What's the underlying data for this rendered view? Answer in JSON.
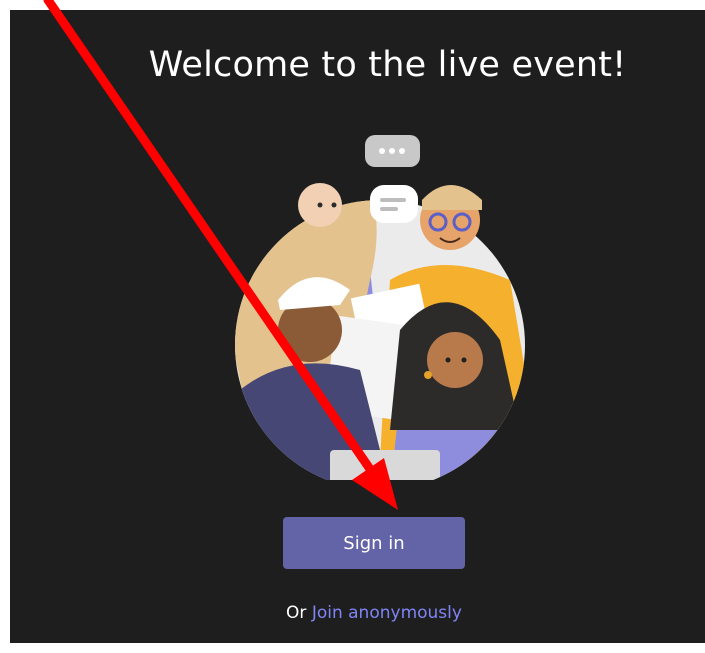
{
  "welcome": {
    "title": "Welcome to the live event!"
  },
  "actions": {
    "signin_label": "Sign in",
    "or_text": "Or ",
    "join_label": "Join anonymously"
  },
  "colors": {
    "background": "#1f1e1f",
    "button": "#6264a7",
    "link": "#7f85f5",
    "annotation_arrow": "#ff0000"
  },
  "icons": {
    "illustration": "people-group-illustration",
    "annotation": "red-arrow-annotation"
  }
}
